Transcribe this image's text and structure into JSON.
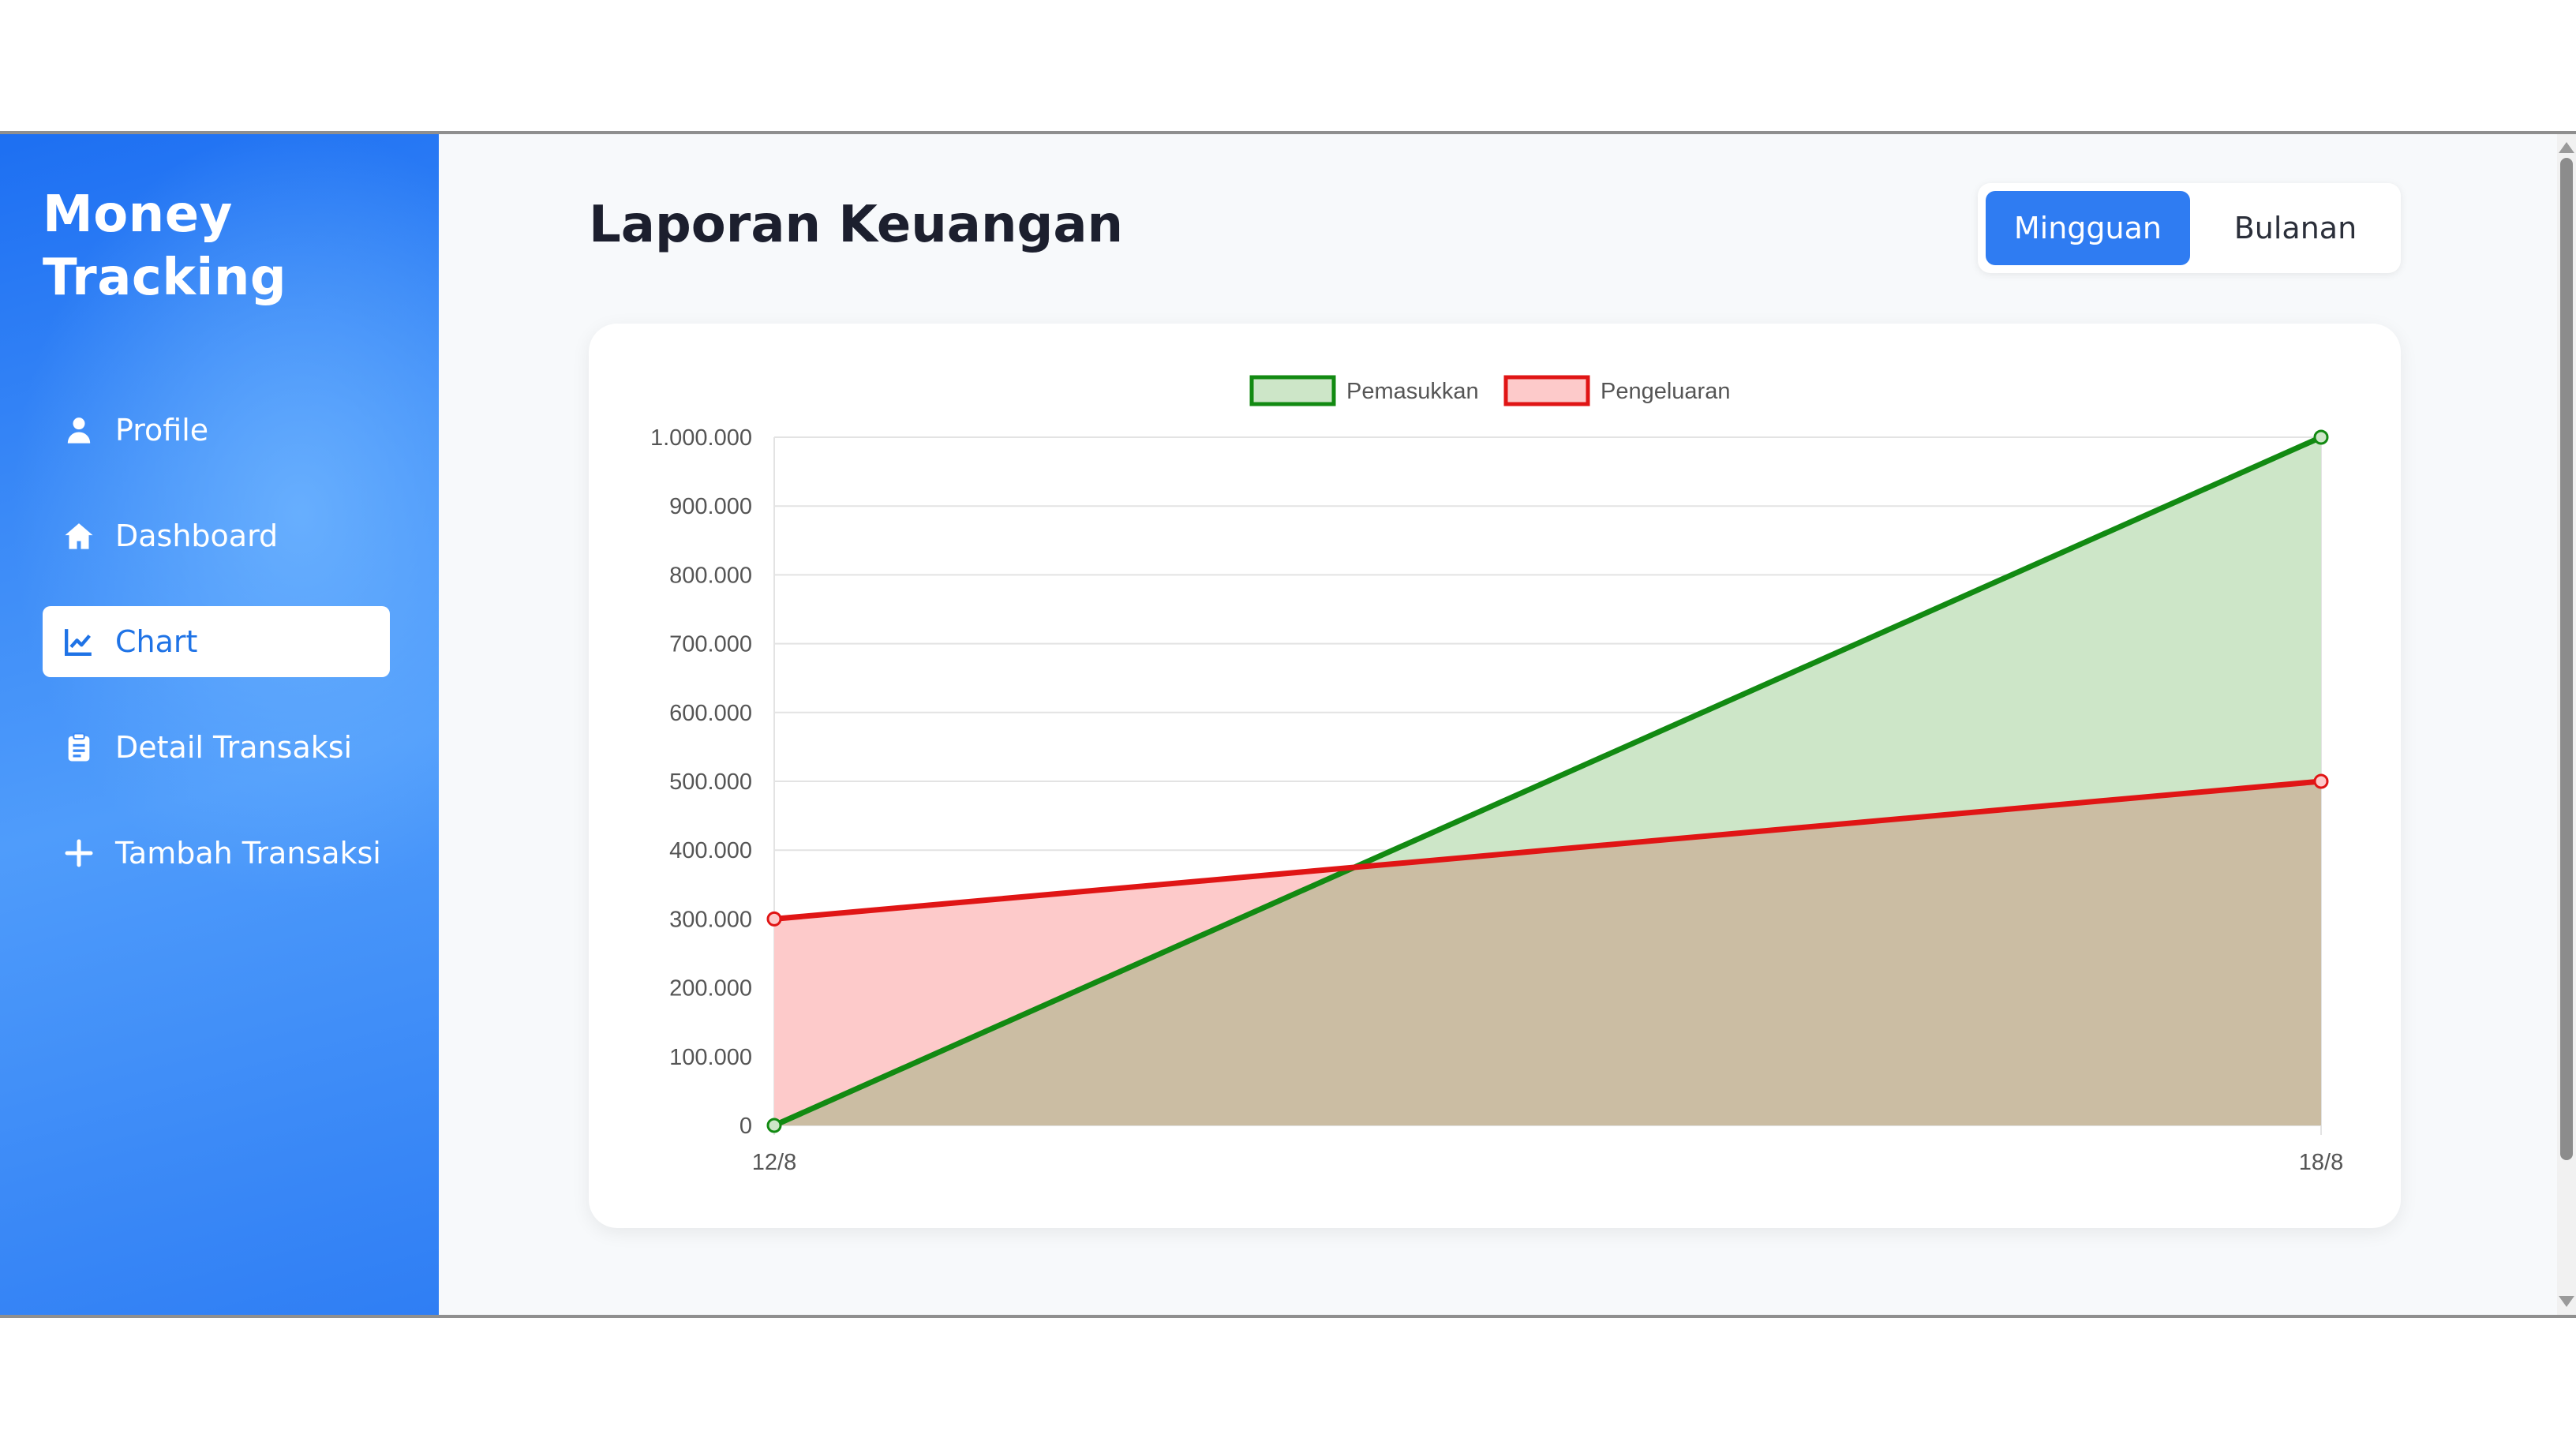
{
  "app": {
    "brand_line1": "Money",
    "brand_line2": "Tracking"
  },
  "sidebar": {
    "items": [
      {
        "label": "Profile",
        "icon": "user-icon"
      },
      {
        "label": "Dashboard",
        "icon": "home-icon"
      },
      {
        "label": "Chart",
        "icon": "line-chart-icon",
        "active": true
      },
      {
        "label": "Detail Transaksi",
        "icon": "clipboard-icon"
      },
      {
        "label": "Tambah Transaksi",
        "icon": "plus-icon"
      }
    ]
  },
  "main": {
    "title": "Laporan Keuangan",
    "period_toggle": {
      "weekly": "Mingguan",
      "monthly": "Bulanan",
      "selected": "weekly"
    }
  },
  "colors": {
    "accent": "#2f7cf2",
    "income_line": "#128a12",
    "income_fill": "#cde6c8",
    "expense_line": "#e01515",
    "expense_fill": "#fdcaca",
    "overlap_fill": "#cbbda3"
  },
  "chart_data": {
    "type": "area",
    "x": [
      "12/8",
      "18/8"
    ],
    "series": [
      {
        "name": "Pemasukkan",
        "values": [
          0,
          1000000
        ]
      },
      {
        "name": "Pengeluaran",
        "values": [
          300000,
          500000
        ]
      }
    ],
    "yticks": [
      "0",
      "100.000",
      "200.000",
      "300.000",
      "400.000",
      "500.000",
      "600.000",
      "700.000",
      "800.000",
      "900.000",
      "1.000.000"
    ],
    "ylim": [
      0,
      1000000
    ],
    "grid": true,
    "legend": "top"
  }
}
